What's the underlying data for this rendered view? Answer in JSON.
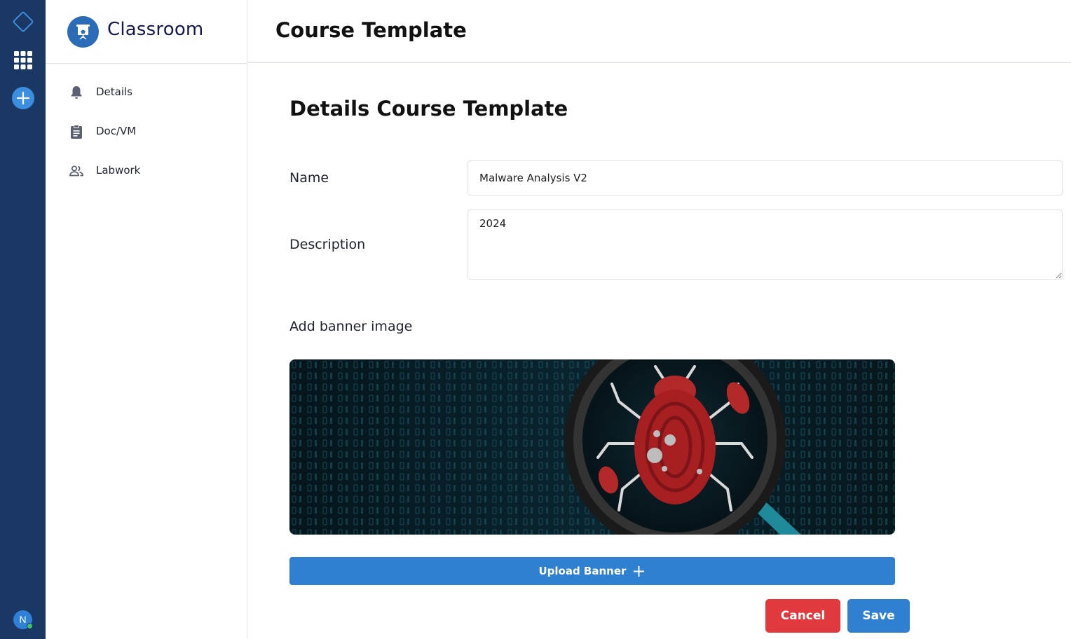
{
  "rail": {
    "icons": [
      "diamond-logo-icon",
      "apps-grid-icon",
      "add-circle-icon"
    ],
    "user_initial": "N",
    "colors": {
      "background": "#1b3763",
      "accent": "#3b8ee0",
      "status": "#3ec46d"
    }
  },
  "sidebar": {
    "brand_title": "Classroom",
    "items": [
      {
        "label": "Details",
        "icon": "bell-icon"
      },
      {
        "label": "Doc/VM",
        "icon": "clipboard-icon"
      },
      {
        "label": "Labwork",
        "icon": "people-icon"
      }
    ]
  },
  "header": {
    "title": "Course Template"
  },
  "form": {
    "section_title": "Details Course Template",
    "name_label": "Name",
    "name_value": "Malware Analysis V2",
    "description_label": "Description",
    "description_value": "2024",
    "banner_label": "Add banner image",
    "banner_image": "malware-bug-magnifier-banner"
  },
  "actions": {
    "upload_label": "Upload Banner",
    "upload_icon": "plus-icon",
    "cancel_label": "Cancel",
    "save_label": "Save",
    "colors": {
      "primary": "#2f80d1",
      "danger": "#e03a3e"
    }
  }
}
